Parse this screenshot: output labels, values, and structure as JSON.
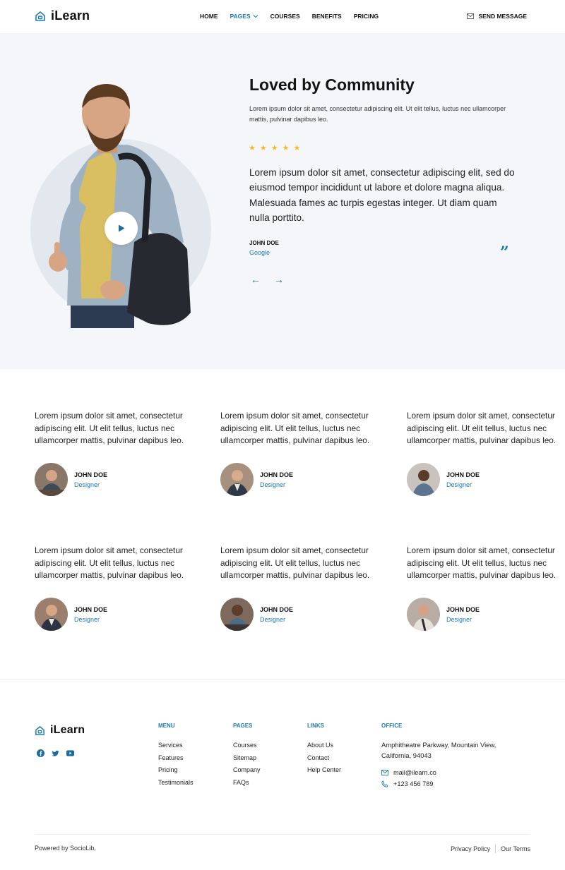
{
  "brand": {
    "name": "iLearn",
    "accent": "#1f7bb3",
    "star_color": "#f5b82e",
    "hero_bg": "#f4f6fa"
  },
  "nav": {
    "items": [
      {
        "label": "HOME",
        "active": false
      },
      {
        "label": "PAGES",
        "active": true,
        "has_dropdown": true
      },
      {
        "label": "COURSES",
        "active": false
      },
      {
        "label": "BENEFITS",
        "active": false
      },
      {
        "label": "PRICING",
        "active": false
      }
    ],
    "send_message": "SEND MESSAGE"
  },
  "hero": {
    "title": "Loved by Community",
    "subtitle": "Lorem ipsum dolor sit amet, consectetur adipiscing elit. Ut elit tellus, luctus nec ullamcorper mattis, pulvinar dapibus leo.",
    "rating": 5,
    "quote": "Lorem ipsum dolor sit amet, consectetur adipiscing elit, sed do eiusmod tempor incididunt ut labore et dolore magna aliqua. Malesuada fames ac turpis egestas integer. Ut diam quam nulla porttito.",
    "author": "JOHN DOE",
    "company": "Google"
  },
  "testimonials": [
    {
      "text": "Lorem ipsum dolor sit amet, consectetur adipiscing elit. Ut elit tellus, luctus nec ullamcorper mattis, pulvinar dapibus leo.",
      "name": "JOHN DOE",
      "role": "Designer"
    },
    {
      "text": "Lorem ipsum dolor sit amet, consectetur adipiscing elit. Ut elit tellus, luctus nec ullamcorper mattis, pulvinar dapibus leo.",
      "name": "JOHN DOE",
      "role": "Designer"
    },
    {
      "text": "Lorem ipsum dolor sit amet, consectetur adipiscing elit. Ut elit tellus, luctus nec ullamcorper mattis, pulvinar dapibus leo.",
      "name": "JOHN DOE",
      "role": "Designer"
    },
    {
      "text": "Lorem ipsum dolor sit amet, consectetur adipiscing elit. Ut elit tellus, luctus nec ullamcorper mattis, pulvinar dapibus leo.",
      "name": "JOHN DOE",
      "role": "Designer"
    },
    {
      "text": "Lorem ipsum dolor sit amet, consectetur adipiscing elit. Ut elit tellus, luctus nec ullamcorper mattis, pulvinar dapibus leo.",
      "name": "JOHN DOE",
      "role": "Designer"
    },
    {
      "text": "Lorem ipsum dolor sit amet, consectetur adipiscing elit. Ut elit tellus, luctus nec ullamcorper mattis, pulvinar dapibus leo.",
      "name": "JOHN DOE",
      "role": "Designer"
    }
  ],
  "footer": {
    "brand": "iLearn",
    "socials": [
      "facebook-icon",
      "twitter-icon",
      "youtube-icon"
    ],
    "menu": {
      "heading": "MENU",
      "items": [
        "Services",
        "Features",
        "Pricing",
        "Testimonials"
      ]
    },
    "pages": {
      "heading": "PAGES",
      "items": [
        "Courses",
        "Sitemap",
        "Company",
        "FAQs"
      ]
    },
    "links": {
      "heading": "LINKS",
      "items": [
        "About Us",
        "Contact",
        "Help Center"
      ]
    },
    "office": {
      "heading": "OFFICE",
      "address": "Amphitheatre Parkway, Mountain View, California, 94043",
      "email": "mail@ilearn.co",
      "phone": "+123 456 789"
    },
    "powered": "Powered by SocioLib.",
    "privacy": "Privacy Policy",
    "terms": "Our Terms"
  }
}
